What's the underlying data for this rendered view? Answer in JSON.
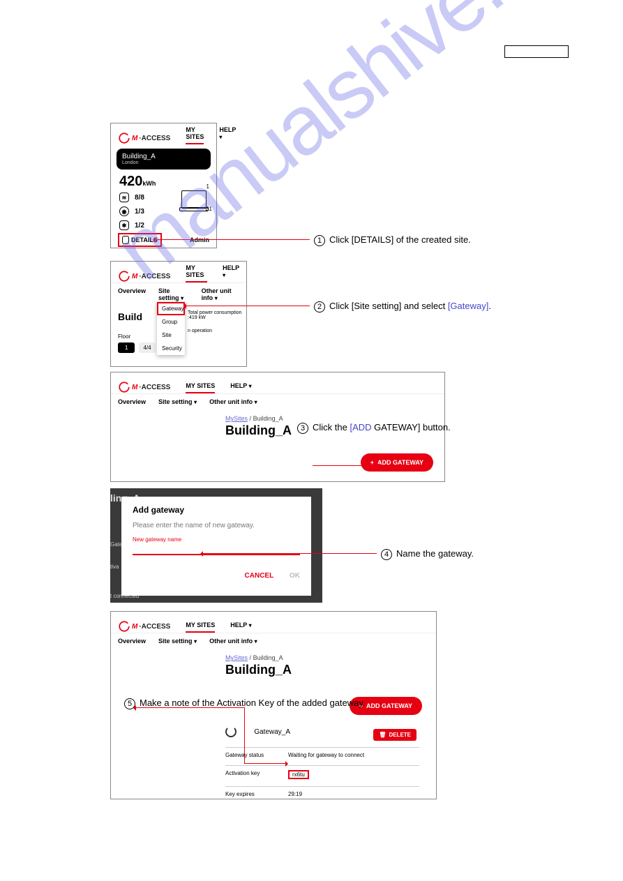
{
  "watermark": "manualshive.com",
  "logo": {
    "brand_m": "M",
    "brand_rest": "·ACCESS"
  },
  "header": {
    "my_sites": "MY SITES",
    "help": "HELP"
  },
  "nav": {
    "overview": "Overview",
    "site_setting": "Site setting",
    "other_unit_info": "Other unit info"
  },
  "panel1": {
    "site_name": "Building_A",
    "site_sub": "London",
    "kwh_value": "420",
    "kwh_unit": "kWh",
    "stat1": "8/8",
    "stat2": "1/3",
    "stat3": "1/2",
    "laptop_top": "1",
    "laptop_bottom": "B1",
    "details": "DETAILS",
    "admin": "Admin"
  },
  "panel2": {
    "building_partial": "Build",
    "power_line": "Total power consumption :419 kW",
    "floor": "Floor",
    "floor_val": "1",
    "op_partial": "n operation",
    "count_partial": "4/4",
    "dropdown": {
      "gateway": "Gateway",
      "group": "Group",
      "site": "Site",
      "security": "Security"
    }
  },
  "panel3": {
    "crumb_mysites": "MySites",
    "crumb_sep": "/",
    "crumb_building": "Building_A",
    "title": "Building_A",
    "add_gateway": "ADD GATEWAY"
  },
  "panel4": {
    "edge_title": "ling_A",
    "modal_title": "Add gateway",
    "hint": "Please enter the name of new gateway.",
    "label": "New gateway name",
    "cancel": "CANCEL",
    "ok": "OK",
    "edge_gate": "Gate",
    "edge_tiva": "tiva",
    "edge_conn": "t connected"
  },
  "panel5": {
    "crumb_mysites": "MySites",
    "crumb_building": "Building_A",
    "title": "Building_A",
    "add_gateway": "ADD GATEWAY",
    "delete": "DELETE",
    "gateway_name": "Gateway_A",
    "status_k": "Gateway status",
    "status_v": "Waiting for gateway to connect",
    "actkey_k": "Activation key",
    "actkey_v": "rx6tu",
    "expires_k": "Key expires",
    "expires_v": "29:19"
  },
  "callouts": {
    "c1_num": "1",
    "c1_a": "Click [DETAILS] of the created site.",
    "c2_num": "2",
    "c2_a": "Click [Site setting] and select ",
    "c2_link": "[Gateway]",
    "c2_b": ".",
    "c3_num": "3",
    "c3_a": "Click the ",
    "c3_link": "[ADD",
    "c3_b": " GATEWAY] button.",
    "c4_num": "4",
    "c4_a": "Name the gateway.",
    "c5_num": "5",
    "c5_a": "Make a note of the Activation Key of the added gateway."
  }
}
